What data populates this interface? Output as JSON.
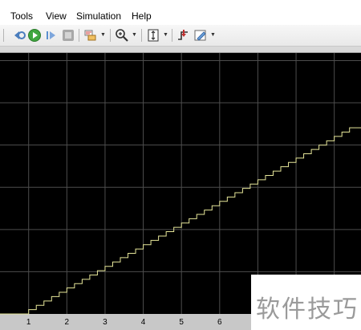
{
  "menu": {
    "items": [
      "Tools",
      "View",
      "Simulation",
      "Help"
    ]
  },
  "toolbar": {
    "icons": [
      "step-back-icon",
      "run-icon",
      "step-forward-icon",
      "stop-icon",
      "style-icon",
      "zoom-icon",
      "fit-axes-icon",
      "triggers-icon",
      "highlight-icon"
    ]
  },
  "colors": {
    "plot_bg": "#000000",
    "grid": "#4d4d4d",
    "signal": "#e6e699",
    "tick_label": "#000000"
  },
  "chart_data": {
    "type": "line",
    "title": "",
    "xlabel": "",
    "ylabel": "",
    "grid": true,
    "x_ticks": [
      "1",
      "2",
      "3",
      "4",
      "5",
      "6"
    ],
    "xlim": [
      0.25,
      9.7
    ],
    "ylim": [
      0,
      6.18
    ],
    "series": [
      {
        "style": "staircase",
        "start_x": 1.0,
        "step": 0.2,
        "initial_value": 0,
        "final_x": 9.7,
        "final_value": 4.46
      }
    ]
  },
  "watermark": {
    "text": "软件技巧"
  }
}
